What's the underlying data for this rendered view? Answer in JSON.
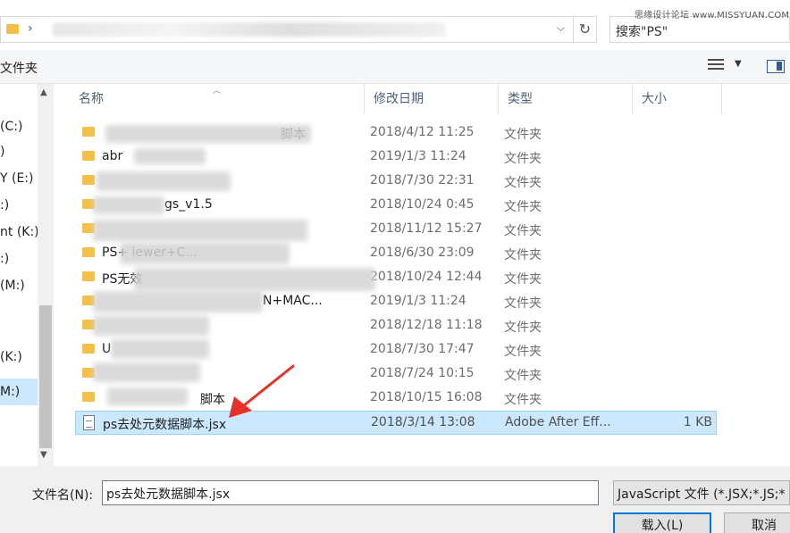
{
  "address_bar": {
    "dropdown": "⌵",
    "refresh": "↻"
  },
  "search": {
    "placeholder": "搜索\"PS\""
  },
  "watermark": "思缘设计论坛 www.MISSYUAN.COM",
  "toolbar": {
    "new_folder": "文件夹"
  },
  "nav": {
    "items": [
      {
        "label": "(C:)",
        "selected": false
      },
      {
        "label": ")",
        "selected": false
      },
      {
        "label": "Y (E:)",
        "selected": false
      },
      {
        "label": ":)",
        "selected": false
      },
      {
        "label": "nt (K:)",
        "selected": false
      },
      {
        "label": ":)",
        "selected": false
      },
      {
        "label": "(M:)",
        "selected": false
      },
      {
        "label": "(K:)",
        "selected": false
      },
      {
        "label": "M:)",
        "selected": true
      }
    ]
  },
  "columns": {
    "name": "名称",
    "date": "修改日期",
    "type": "类型",
    "size": "大小"
  },
  "rows": [
    {
      "name": "脚本",
      "date": "2018/4/12 11:25",
      "type": "文件夹",
      "size": ""
    },
    {
      "name": "abr",
      "date": "2019/1/3 11:24",
      "type": "文件夹",
      "size": ""
    },
    {
      "name": "",
      "date": "2018/7/30 22:31",
      "type": "文件夹",
      "size": ""
    },
    {
      "name": "gs_v1.5",
      "date": "2018/10/24 0:45",
      "type": "文件夹",
      "size": ""
    },
    {
      "name": "",
      "date": "2018/11/12 15:27",
      "type": "文件夹",
      "size": ""
    },
    {
      "name": "PS+                  iewer+C...",
      "date": "2018/6/30 23:09",
      "type": "文件夹",
      "size": ""
    },
    {
      "name": "PS无效",
      "date": "2018/10/24 12:44",
      "type": "文件夹",
      "size": ""
    },
    {
      "name": "N+MAC...",
      "date": "2019/1/3 11:24",
      "type": "文件夹",
      "size": ""
    },
    {
      "name": "",
      "date": "2018/12/18 11:18",
      "type": "文件夹",
      "size": ""
    },
    {
      "name": "U",
      "date": "2018/7/30 17:47",
      "type": "文件夹",
      "size": ""
    },
    {
      "name": "",
      "date": "2018/7/24 10:15",
      "type": "文件夹",
      "size": ""
    },
    {
      "name": "脚本",
      "date": "2018/10/15 16:08",
      "type": "文件夹",
      "size": ""
    }
  ],
  "selected_file": {
    "name": "ps去处元数据脚本.jsx",
    "date": "2018/3/14 13:08",
    "type": "Adobe After Eff...",
    "size": "1 KB"
  },
  "bottom": {
    "filename_label": "文件名(N):",
    "filename_value": "ps去处元数据脚本.jsx",
    "filter": "JavaScript 文件 (*.JSX;*.JS;*",
    "open_button": "载入(L)",
    "cancel_button": "取消"
  },
  "colors": {
    "selection": "#cce8ff",
    "accent": "#0078d7",
    "annotation_arrow": "#e8302a"
  }
}
